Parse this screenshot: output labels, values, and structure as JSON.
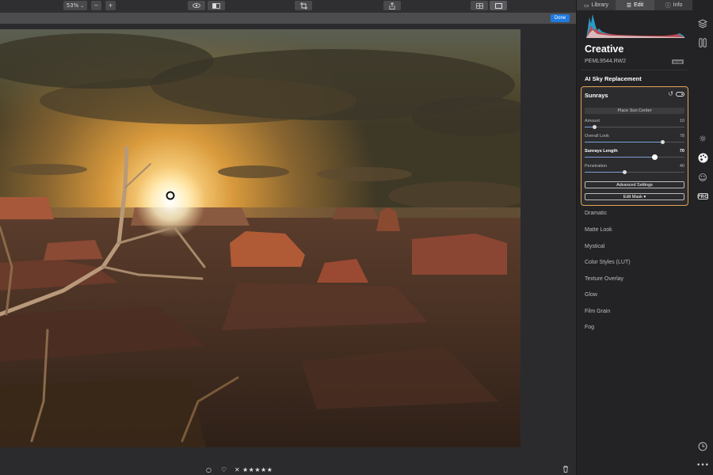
{
  "toolbar": {
    "zoom": "53%",
    "zoom_caret": "⌄",
    "zoom_out": "−",
    "zoom_in": "+",
    "done_label": "Done"
  },
  "tabs": [
    {
      "label": "Library",
      "icon": "library-icon",
      "glyph": "▭"
    },
    {
      "label": "Edit",
      "icon": "sliders-icon",
      "glyph": "☰"
    },
    {
      "label": "Info",
      "icon": "info-icon",
      "glyph": "ⓘ"
    }
  ],
  "panel": {
    "module_title": "Creative",
    "filename": "PEML9544.RW2",
    "raw_badge": "RAW",
    "ai_sky": "AI Sky Replacement",
    "sunrays": {
      "title": "Sunrays",
      "place_sun_center": "Place Sun Center",
      "sliders": [
        {
          "label": "Amount",
          "value": "10",
          "fraction": 0.1
        },
        {
          "label": "Overall Look",
          "value": "78",
          "fraction": 0.78
        },
        {
          "label": "Sunrays Length",
          "value": "70",
          "fraction": 0.7
        },
        {
          "label": "Penetration",
          "value": "40",
          "fraction": 0.4
        }
      ],
      "advanced_settings": "Advanced Settings",
      "edit_mask": "Edit Mask ▾"
    },
    "filters": [
      "Dramatic",
      "Matte Look",
      "Mystical",
      "Color Styles (LUT)",
      "Texture Overlay",
      "Glow",
      "Film Grain",
      "Fog"
    ]
  },
  "bottombar": {
    "rating_stars": "★★★★★",
    "pick_icon": "○",
    "heart_icon": "♡",
    "reject_icon": "✕"
  },
  "rail": {
    "pro_label": "PRO"
  },
  "colors": {
    "accent": "#1f7ae0",
    "module_outline": "#e3a55a",
    "slider_fill": "#7b9fd6"
  }
}
